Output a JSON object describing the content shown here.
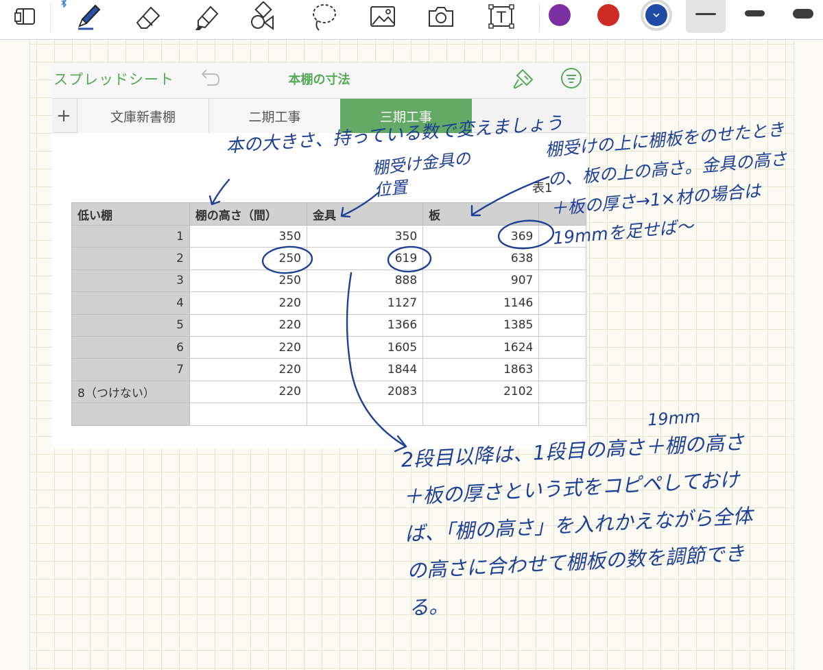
{
  "toolbar": {
    "tools": [
      "notebook-icon",
      "pen-icon",
      "eraser-icon",
      "highlighter-icon",
      "shapes-icon",
      "lasso-icon",
      "image-icon",
      "camera-icon",
      "text-tool-icon"
    ],
    "colors": [
      "#7b2fa0",
      "#cf2a23",
      "#1f4aa5"
    ],
    "selected_color": "#1f4aa5",
    "thickness_options": [
      "thin",
      "medium",
      "thick"
    ]
  },
  "sheet": {
    "back_label": "スプレッドシート",
    "title": "本棚の寸法",
    "tabs": [
      "文庫新書棚",
      "二期工事",
      "三期工事"
    ],
    "active_tab": "三期工事",
    "table_title": "表1",
    "columns": [
      "低い棚",
      "棚の高さ（間）",
      "金具",
      "板",
      ""
    ],
    "rows": [
      [
        "1",
        "350",
        "350",
        "369",
        ""
      ],
      [
        "2",
        "250",
        "619",
        "638",
        ""
      ],
      [
        "3",
        "250",
        "888",
        "907",
        ""
      ],
      [
        "4",
        "220",
        "1127",
        "1146",
        ""
      ],
      [
        "5",
        "220",
        "1366",
        "1385",
        ""
      ],
      [
        "6",
        "220",
        "1605",
        "1624",
        ""
      ],
      [
        "7",
        "220",
        "1844",
        "1863",
        ""
      ],
      [
        "8（つけない）",
        "220",
        "2083",
        "2102",
        ""
      ],
      [
        "",
        "",
        "",
        "",
        ""
      ]
    ]
  },
  "annotations": {
    "note_book_size": "本の大きさ、持っている数で変えましょう",
    "note_bracket_pos": "棚受け金具の位置",
    "note_plank_top": "棚受けの上に棚板をのせたときの、板の上の高さ。金具の高さ＋板の厚さ→1×材の場合は19mmを足せば〜",
    "note_19mm": "19mm",
    "note_formula": "2段目以降は、1段目の高さ＋棚の高さ＋板の厚さという式をコピペしておけば、「棚の高さ」を入れかえながら全体の高さに合わせて棚板の数を調節できる。"
  }
}
